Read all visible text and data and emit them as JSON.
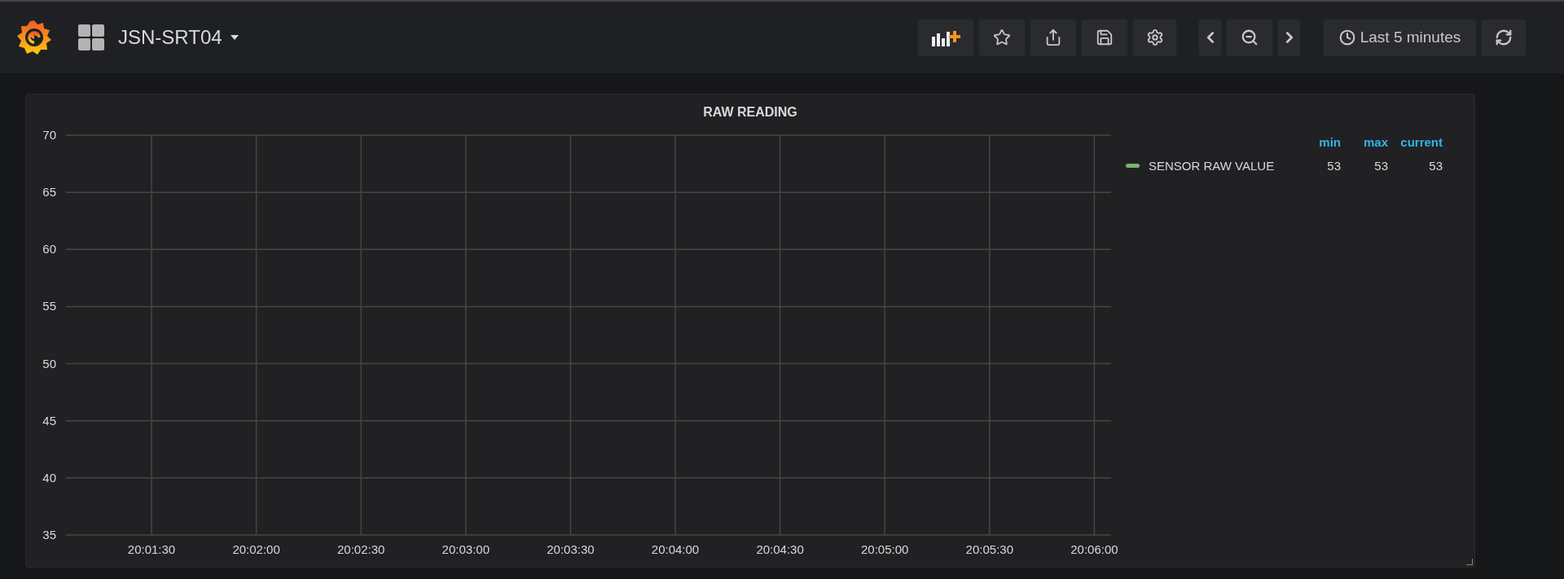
{
  "header": {
    "dashboard_title": "JSN-SRT04",
    "time_range": "Last 5 minutes"
  },
  "panel": {
    "title": "RAW READING",
    "chart_data": {
      "type": "line",
      "categories": [
        "20:01:30",
        "20:02:00",
        "20:02:30",
        "20:03:00",
        "20:03:30",
        "20:04:00",
        "20:04:30",
        "20:05:00",
        "20:05:30",
        "20:06:00"
      ],
      "ylim": [
        35,
        70
      ],
      "grid": true,
      "yticks": [
        35,
        40,
        45,
        50,
        55,
        60,
        65,
        70
      ]
    },
    "legend": {
      "columns": [
        "min",
        "max",
        "current"
      ],
      "rows": [
        {
          "name": "SENSOR RAW VALUE",
          "color": "#7eb26d",
          "values": [
            "53",
            "53",
            "53"
          ]
        }
      ]
    }
  }
}
